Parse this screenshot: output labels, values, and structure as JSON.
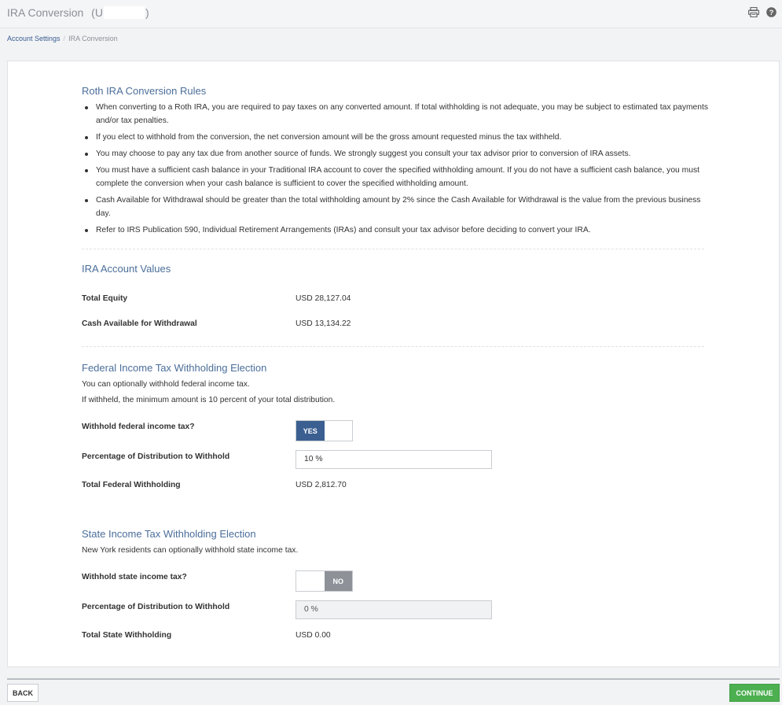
{
  "header": {
    "title": "IRA Conversion",
    "account_prefix": "(U",
    "account_suffix": ")"
  },
  "breadcrumb": {
    "parent": "Account Settings",
    "separator": "/",
    "current": "IRA Conversion"
  },
  "rules": {
    "title": "Roth IRA Conversion Rules",
    "items": [
      "When converting to a Roth IRA, you are required to pay taxes on any converted amount. If total withholding is not adequate, you may be subject to estimated tax payments and/or tax penalties.",
      "If you elect to withhold from the conversion, the net conversion amount will be the gross amount requested minus the tax withheld.",
      "You may choose to pay any tax due from another source of funds. We strongly suggest you consult your tax advisor prior to conversion of IRA assets.",
      "You must have a sufficient cash balance in your Traditional IRA account to cover the specified withholding amount. If you do not have a sufficient cash balance, you must complete the conversion when your cash balance is sufficient to cover the specified withholding amount.",
      "Cash Available for Withdrawal should be greater than the total withholding amount by 2% since the Cash Available for Withdrawal is the value from the previous business day.",
      "Refer to IRS Publication 590, Individual Retirement Arrangements (IRAs) and consult your tax advisor before deciding to convert your IRA."
    ]
  },
  "account_values": {
    "title": "IRA Account Values",
    "total_equity_label": "Total Equity",
    "total_equity_value": "USD 28,127.04",
    "cash_label": "Cash Available for Withdrawal",
    "cash_value": "USD 13,134.22"
  },
  "federal": {
    "title": "Federal Income Tax Withholding Election",
    "desc1": "You can optionally withhold federal income tax.",
    "desc2": "If withheld, the minimum amount is 10 percent of your total distribution.",
    "withhold_label": "Withhold federal income tax?",
    "toggle_label": "YES",
    "percent_label": "Percentage of Distribution to Withhold",
    "percent_value": "10 %",
    "total_label": "Total Federal Withholding",
    "total_value": "USD 2,812.70"
  },
  "state": {
    "title": "State Income Tax Withholding Election",
    "desc": "New York residents can optionally withhold state income tax.",
    "withhold_label": "Withhold state income tax?",
    "toggle_label": "NO",
    "percent_label": "Percentage of Distribution to Withhold",
    "percent_value": "0 %",
    "total_label": "Total State Withholding",
    "total_value": "USD 0.00"
  },
  "footer": {
    "back_label": "BACK",
    "continue_label": "CONTINUE"
  },
  "icons": {
    "print": "print-icon",
    "help": "help-icon"
  },
  "colors": {
    "accent": "#3b5f91",
    "section_title": "#4b6e9a",
    "continue": "#4caf50",
    "toggle_off": "#8e9298"
  }
}
